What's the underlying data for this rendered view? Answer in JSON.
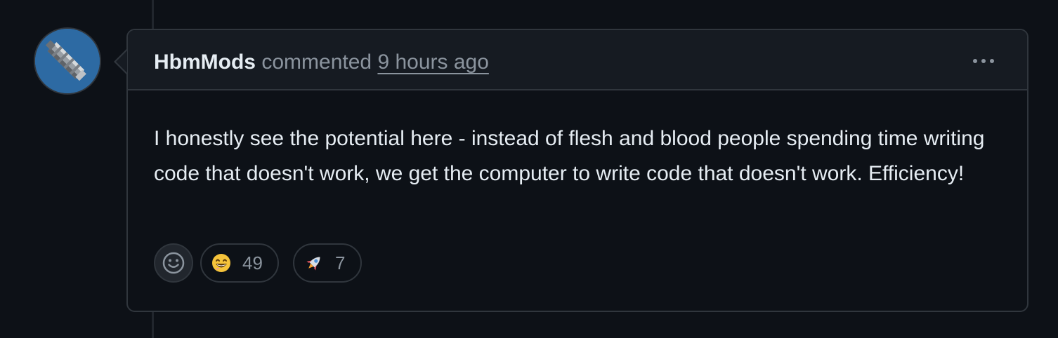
{
  "comment": {
    "author": "HbmMods",
    "action": "commented",
    "timestamp": "9 hours ago",
    "body": "I honestly see the potential here - instead of flesh and blood people spending time writing code that doesn't work, we get the computer to write code that doesn't work. Efficiency!",
    "avatar_icon": "pixel-art-avatar",
    "more_icon": "kebab-horizontal-icon",
    "reactions": [
      {
        "icon": "grinning-face-emoji",
        "count": "49"
      },
      {
        "icon": "rocket-emoji",
        "count": "7"
      }
    ],
    "add_reaction_icon": "smiley-icon"
  },
  "colors": {
    "background": "#0d1117",
    "header_background": "#161b22",
    "border": "#30363d",
    "text_primary": "#e6edf3",
    "text_muted": "#8b949e",
    "avatar_background": "#2d6aa3"
  }
}
